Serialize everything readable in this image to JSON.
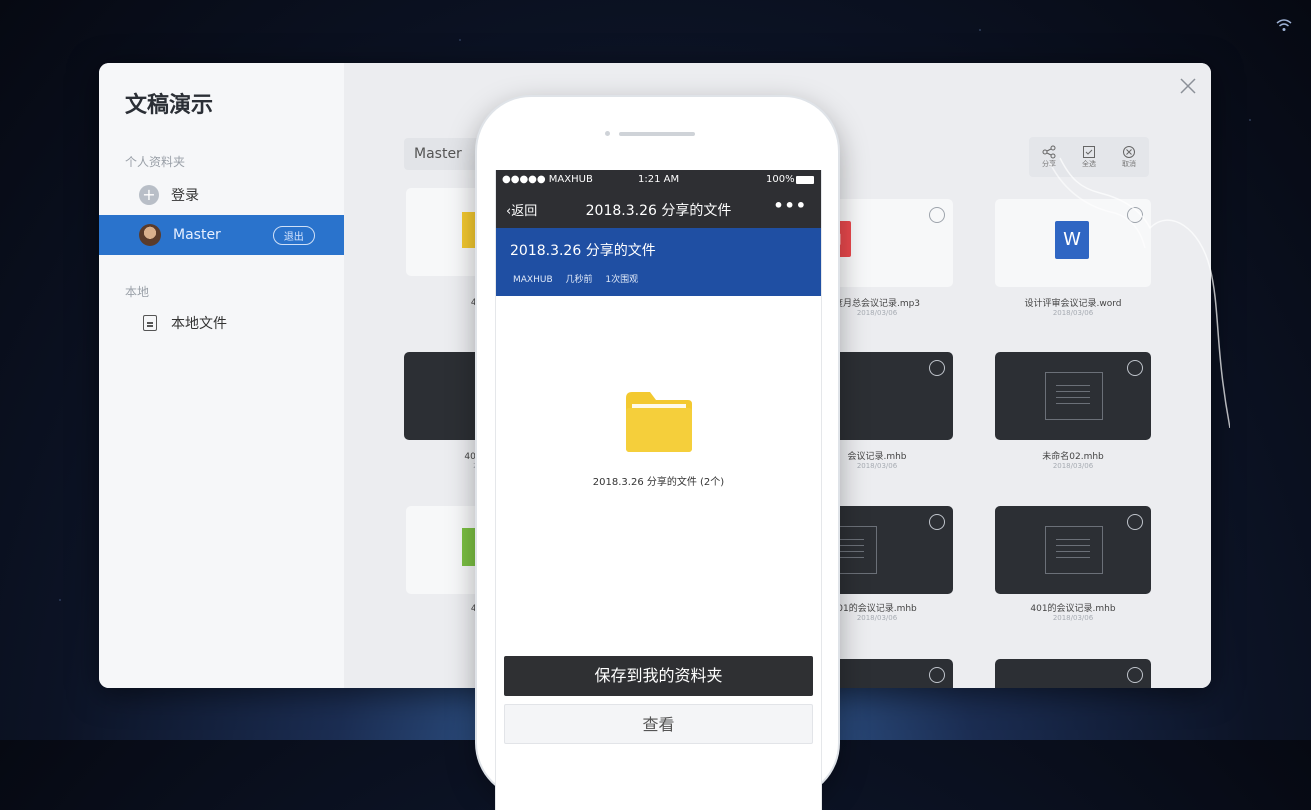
{
  "sidebar": {
    "title": "文稿演示",
    "section_personal": "个人资料夹",
    "login_label": "登录",
    "user_name": "Master",
    "logout_label": "退出",
    "section_local": "本地",
    "local_files_label": "本地文件"
  },
  "main": {
    "search_value": "Master",
    "toolbar": {
      "tool1": "分享",
      "tool2": "全选",
      "tool3": "取消"
    },
    "files": [
      {
        "name": "401的",
        "date": "2018"
      },
      {
        "name": "度月总会议记录.mp3",
        "date": "2018/03/06"
      },
      {
        "name": "设计评审会议记录.word",
        "date": "2018/03/06"
      },
      {
        "name": "401的会",
        "date": "2018"
      },
      {
        "name": "会议记录.mhb",
        "date": "2018/03/06"
      },
      {
        "name": "未命名02.mhb",
        "date": "2018/03/06"
      },
      {
        "name": "401的",
        "date": "2018"
      },
      {
        "name": "01的会议记录.mhb",
        "date": "2018/03/06"
      },
      {
        "name": "401的会议记录.mhb",
        "date": "2018/03/06"
      }
    ]
  },
  "phone": {
    "carrier": "●●●●● MAXHUB",
    "time": "1:21 AM",
    "battery": "100%",
    "back_label": "返回",
    "nav_title": "2018.3.26 分享的文件",
    "more": "•••",
    "banner_title": "2018.3.26 分享的文件",
    "meta_source": "MAXHUB",
    "meta_time": "几秒前",
    "meta_views": "1次围观",
    "folder_label": "2018.3.26 分享的文件 (2个)",
    "save_button": "保存到我的资料夹",
    "view_button": "查看"
  },
  "colors": {
    "accent": "#2a73cc",
    "banner": "#1f4fa3",
    "folder": "#f3c930",
    "mp3": "#e8484c",
    "word": "#2f66c3"
  }
}
